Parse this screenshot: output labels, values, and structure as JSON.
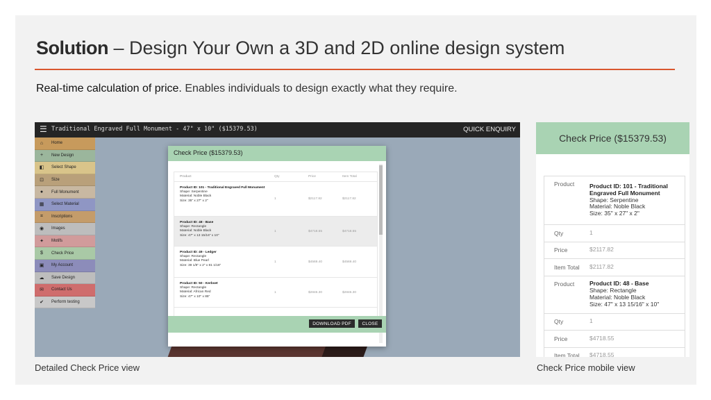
{
  "slide": {
    "title_bold": "Solution",
    "title_rest": " – Design Your Own a 3D and 2D online design system",
    "subtitle_lead": "Real-time calculation of price.",
    "subtitle_rest": " Enables individuals to design exactly what they require.",
    "caption_left": "Detailed Check Price view",
    "caption_right": "Check Price mobile view",
    "accent_color": "#d9562e"
  },
  "app": {
    "menu_icon": "☰",
    "title": "Traditional Engraved Full Monument - 47\" x 10\" ($15379.53)",
    "quick_enquiry": "QUICK ENQUIRY",
    "sidebar": [
      {
        "label": "Home",
        "icon": "⌂",
        "color": "#c79a5c"
      },
      {
        "label": "New Design",
        "icon": "+",
        "color": "#9bb69c"
      },
      {
        "label": "Select Shape",
        "icon": "◧",
        "color": "#d9c48a"
      },
      {
        "label": "Size",
        "icon": "⊡",
        "color": "#b9a07a"
      },
      {
        "label": "Full Monument",
        "icon": "●",
        "color": "#c8b8a2"
      },
      {
        "label": "Select Material",
        "icon": "▦",
        "color": "#8f96c4"
      },
      {
        "label": "Inscriptions",
        "icon": "⌗",
        "color": "#c49c6a"
      },
      {
        "label": "Images",
        "icon": "◉",
        "color": "#bdbdbd"
      },
      {
        "label": "Motifs",
        "icon": "✦",
        "color": "#d19b9b"
      },
      {
        "label": "Check Price",
        "icon": "$",
        "color": "#a9c9a6"
      },
      {
        "label": "My Account",
        "icon": "▣",
        "color": "#8c8cba"
      },
      {
        "label": "Save Design",
        "icon": "☁",
        "color": "#bdbdbd"
      },
      {
        "label": "Contact Us",
        "icon": "✉",
        "color": "#cf6d6d"
      },
      {
        "label": "Perform testing",
        "icon": "✔",
        "color": "#c8c8c8"
      }
    ]
  },
  "modal": {
    "title": "Check Price ($15379.53)",
    "headers": [
      "Product",
      "Qty",
      "Price",
      "Item Total"
    ],
    "rows": [
      {
        "name": "Product ID: 101 - Traditional Engraved Full Monument",
        "shape": "Shape: Serpentine",
        "material": "Material: Noble Black",
        "size": "Size: 35\" x 27\" x 2\"",
        "qty": "1",
        "price": "$2117.82",
        "total": "$2117.82"
      },
      {
        "name": "Product ID: 48 - Base",
        "shape": "Shape: Rectangle",
        "material": "Material: Noble Black",
        "size": "Size: 47\" x 13 15/16\" x 10\"",
        "qty": "1",
        "price": "$4718.55",
        "total": "$4718.55"
      },
      {
        "name": "Product ID: 49 - Ledger",
        "shape": "Shape: Rectangle",
        "material": "Material: Blue Pearl",
        "size": "Size: 39 1/8\" x 2\" x 81 1/16\"",
        "qty": "1",
        "price": "$4569.40",
        "total": "$4569.40"
      },
      {
        "name": "Product ID: 50 - Kerbset",
        "shape": "Shape: Rectangle",
        "material": "Material: African Red",
        "size": "Size: 47\" x 10\" x 85\"",
        "qty": "1",
        "price": "$2846.30",
        "total": "$2846.30"
      }
    ],
    "download_label": "DOWNLOAD PDF",
    "close_label": "CLOSE"
  },
  "mobile": {
    "title": "Check Price ($15379.53)",
    "labels": {
      "product": "Product",
      "qty": "Qty",
      "price": "Price",
      "item_total": "Item Total"
    },
    "items": [
      {
        "name": "Product ID: 101 - Traditional Engraved Full Monument",
        "shape": "Shape: Serpentine",
        "material": "Material: Noble Black",
        "size": "Size: 35\" x 27\" x 2\"",
        "qty": "1",
        "price": "$2117.82",
        "total": "$2117.82"
      },
      {
        "name": "Product ID: 48 - Base",
        "shape": "Shape: Rectangle",
        "material": "Material: Noble Black",
        "size": "Size: 47\" x 13 15/16\" x 10\"",
        "qty": "1",
        "price": "$4718.55",
        "total": "$4718.55"
      }
    ]
  }
}
